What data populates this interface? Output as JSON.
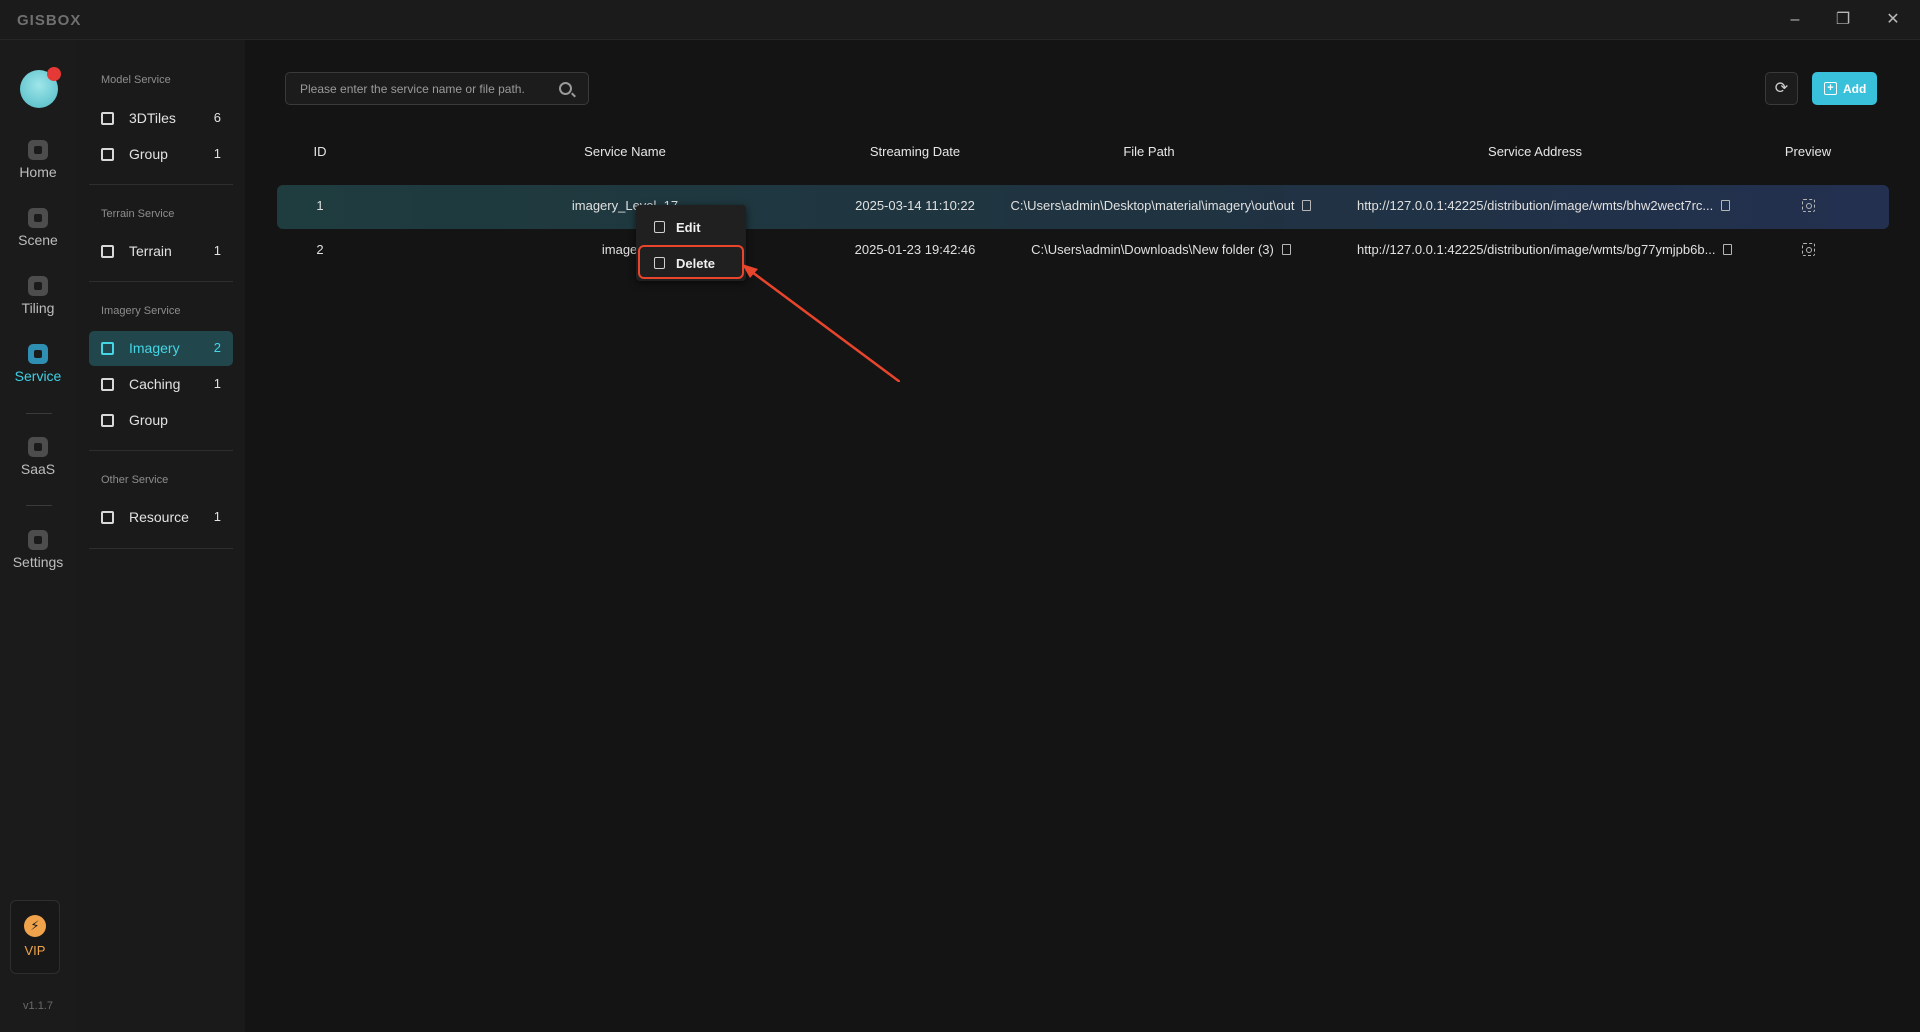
{
  "app": {
    "logo": "GISBOX"
  },
  "window_controls": {
    "minimize": "–",
    "restore": "❐",
    "close": "✕"
  },
  "rail": {
    "items": [
      {
        "label": "Home",
        "icon": "home-icon"
      },
      {
        "label": "Scene",
        "icon": "scene-icon"
      },
      {
        "label": "Tiling",
        "icon": "tiling-icon"
      },
      {
        "label": "Service",
        "icon": "service-icon",
        "active": true
      },
      {
        "label": "SaaS",
        "icon": "saas-icon"
      },
      {
        "label": "Settings",
        "icon": "settings-icon"
      }
    ],
    "vip": {
      "label": "VIP",
      "icon_glyph": "⚡"
    },
    "version": "v1.1.7"
  },
  "sidebar": {
    "groups": [
      {
        "label": "Model Service",
        "items": [
          {
            "label": "3DTiles",
            "count": "6"
          },
          {
            "label": "Group",
            "count": "1"
          }
        ]
      },
      {
        "label": "Terrain Service",
        "items": [
          {
            "label": "Terrain",
            "count": "1"
          }
        ]
      },
      {
        "label": "Imagery Service",
        "items": [
          {
            "label": "Imagery",
            "count": "2",
            "active": true
          },
          {
            "label": "Caching",
            "count": "1"
          },
          {
            "label": "Group",
            "count": ""
          }
        ]
      },
      {
        "label": "Other Service",
        "items": [
          {
            "label": "Resource",
            "count": "1"
          }
        ]
      }
    ]
  },
  "toolbar": {
    "search_placeholder": "Please enter the service name or file path.",
    "refresh_glyph": "⟳",
    "add_label": "Add",
    "add_glyph": "+"
  },
  "table": {
    "headers": [
      "ID",
      "Service Name",
      "Streaming Date",
      "File Path",
      "Service Address",
      "Preview"
    ],
    "rows": [
      {
        "id": "1",
        "name": "imagery_Level_17",
        "date": "2025-03-14 11:10:22",
        "path": "C:\\Users\\admin\\Desktop\\material\\imagery\\out\\out",
        "address": "http://127.0.0.1:42225/distribution/image/wmts/bhw2wect7rc...",
        "selected": true
      },
      {
        "id": "2",
        "name": "imagery",
        "date": "2025-01-23 19:42:46",
        "path": "C:\\Users\\admin\\Downloads\\New folder (3)",
        "address": "http://127.0.0.1:42225/distribution/image/wmts/bg77ymjpb6b...",
        "selected": false
      }
    ]
  },
  "context_menu": {
    "items": [
      {
        "label": "Edit",
        "icon": "edit-icon"
      },
      {
        "label": "Delete",
        "icon": "trash-icon"
      }
    ]
  },
  "colors": {
    "accent": "#39c1dc",
    "annotation": "#e8452c",
    "vip": "#f0a34a"
  }
}
